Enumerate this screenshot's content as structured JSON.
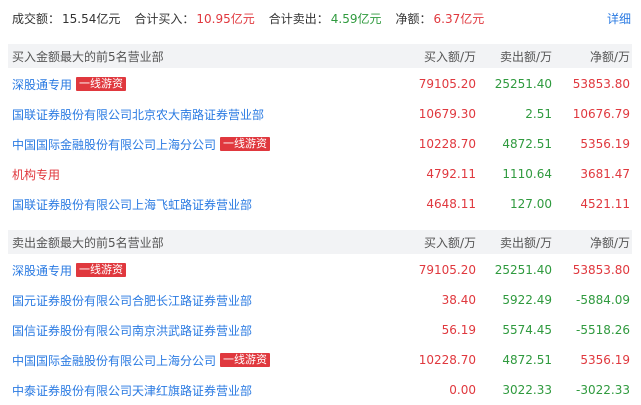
{
  "summary": {
    "total_label": "成交额：",
    "total_value": "15.54亿元",
    "buy_label": "合计买入：",
    "buy_value": "10.95亿元",
    "sell_label": "合计卖出：",
    "sell_value": "4.59亿元",
    "net_label": "净额：",
    "net_value": "6.37亿元",
    "detail_link": "详细"
  },
  "buy_section": {
    "title": "买入金额最大的前5名营业部",
    "col_buy": "买入额/万",
    "col_sell": "卖出额/万",
    "col_net": "净额/万",
    "rows": [
      {
        "name": "深股通专用",
        "badge": "一线游资",
        "buy": "79105.20",
        "sell": "25251.40",
        "net": "53853.80",
        "net_color": "red"
      },
      {
        "name": "国联证券股份有限公司北京农大南路证券营业部",
        "badge": null,
        "buy": "10679.30",
        "sell": "2.51",
        "net": "10676.79",
        "net_color": "red"
      },
      {
        "name": "中国国际金融股份有限公司上海分公司",
        "badge": "一线游资",
        "buy": "10228.70",
        "sell": "4872.51",
        "net": "5356.19",
        "net_color": "red"
      },
      {
        "name": "机构专用",
        "badge": null,
        "buy": "4792.11",
        "sell": "1110.64",
        "net": "3681.47",
        "net_color": "red",
        "institution": true
      },
      {
        "name": "国联证券股份有限公司上海飞虹路证券营业部",
        "badge": null,
        "buy": "4648.11",
        "sell": "127.00",
        "net": "4521.11",
        "net_color": "red"
      }
    ]
  },
  "sell_section": {
    "title": "卖出金额最大的前5名营业部",
    "col_buy": "买入额/万",
    "col_sell": "卖出额/万",
    "col_net": "净额/万",
    "rows": [
      {
        "name": "深股通专用",
        "badge": "一线游资",
        "buy": "79105.20",
        "sell": "25251.40",
        "net": "53853.80",
        "net_color": "red"
      },
      {
        "name": "国元证券股份有限公司合肥长江路证券营业部",
        "badge": null,
        "buy": "38.40",
        "sell": "5922.49",
        "net": "-5884.09",
        "net_color": "green"
      },
      {
        "name": "国信证券股份有限公司南京洪武路证券营业部",
        "badge": null,
        "buy": "56.19",
        "sell": "5574.45",
        "net": "-5518.26",
        "net_color": "green"
      },
      {
        "name": "中国国际金融股份有限公司上海分公司",
        "badge": "一线游资",
        "buy": "10228.70",
        "sell": "4872.51",
        "net": "5356.19",
        "net_color": "red"
      },
      {
        "name": "中泰证券股份有限公司天津红旗路证券营业部",
        "badge": null,
        "buy": "0.00",
        "sell": "3022.33",
        "net": "-3022.33",
        "net_color": "green"
      }
    ]
  },
  "colors": {
    "red": "#e0383e",
    "green": "#2f9a3e",
    "link": "#2a7ae2",
    "header_bg": "#f2f3f5"
  }
}
